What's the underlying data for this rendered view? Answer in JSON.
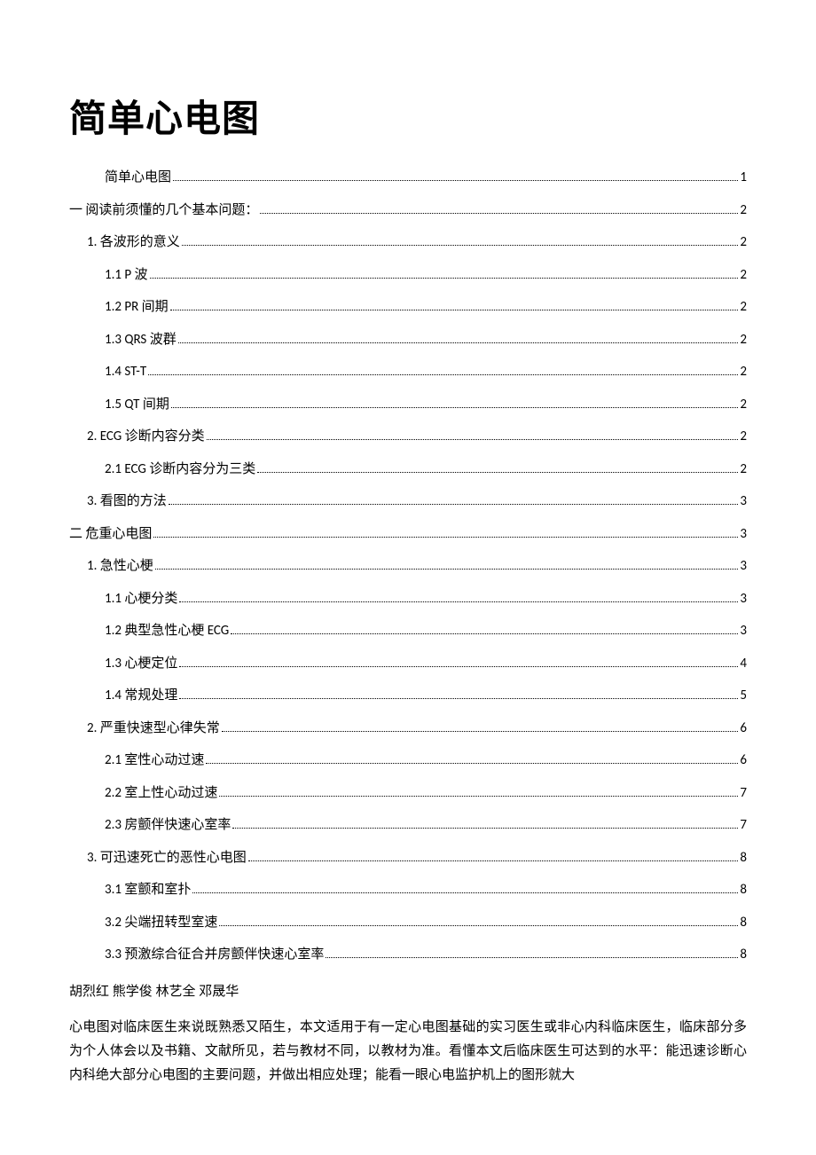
{
  "title": "简单心电图",
  "toc": [
    {
      "label": "简单心电图",
      "page": "1",
      "level": "lvl0c"
    },
    {
      "label": "一  阅读前须懂的几个基本问题：",
      "page": "2",
      "level": "lvl0"
    },
    {
      "label": "1.  各波形的意义",
      "page": "2",
      "level": "lvl1"
    },
    {
      "label": "1.1 P 波",
      "page": "2",
      "level": "lvl2"
    },
    {
      "label": "1.2 PR 间期",
      "page": "2",
      "level": "lvl2"
    },
    {
      "label": "1.3 QRS 波群",
      "page": "2",
      "level": "lvl2"
    },
    {
      "label": "1.4 ST-T",
      "page": "2",
      "level": "lvl2"
    },
    {
      "label": "1.5 QT 间期",
      "page": "2",
      "level": "lvl2"
    },
    {
      "label": "2. ECG 诊断内容分类",
      "page": "2",
      "level": "lvl1"
    },
    {
      "label": "2.1 ECG 诊断内容分为三类",
      "page": "2",
      "level": "lvl2"
    },
    {
      "label": "3.  看图的方法",
      "page": "3",
      "level": "lvl1"
    },
    {
      "label": "二  危重心电图",
      "page": "3",
      "level": "lvl0"
    },
    {
      "label": "1.  急性心梗",
      "page": "3",
      "level": "lvl1"
    },
    {
      "label": "1.1  心梗分类",
      "page": "3",
      "level": "lvl2"
    },
    {
      "label": "1.2  典型急性心梗 ECG",
      "page": "3",
      "level": "lvl2"
    },
    {
      "label": "1.3  心梗定位",
      "page": "4",
      "level": "lvl2"
    },
    {
      "label": "1.4  常规处理",
      "page": "5",
      "level": "lvl2"
    },
    {
      "label": "2.  严重快速型心律失常",
      "page": "6",
      "level": "lvl1"
    },
    {
      "label": "2.1  室性心动过速",
      "page": "6",
      "level": "lvl2"
    },
    {
      "label": "2.2  室上性心动过速",
      "page": "7",
      "level": "lvl2"
    },
    {
      "label": "2.3  房颤伴快速心室率",
      "page": "7",
      "level": "lvl2"
    },
    {
      "label": "3.  可迅速死亡的恶性心电图",
      "page": "8",
      "level": "lvl1"
    },
    {
      "label": "3.1  室颤和室扑",
      "page": "8",
      "level": "lvl2"
    },
    {
      "label": "3.2  尖端扭转型室速",
      "page": "8",
      "level": "lvl2"
    },
    {
      "label": "3.3  预激综合征合并房颤伴快速心室率",
      "page": "8",
      "level": "lvl2"
    }
  ],
  "authors": "胡烈红  熊学俊  林艺全  邓晟华",
  "body_paragraph": "心电图对临床医生来说既熟悉又陌生，本文适用于有一定心电图基础的实习医生或非心内科临床医生，临床部分多为个人体会以及书籍、文献所见，若与教材不同，以教材为准。看懂本文后临床医生可达到的水平：能迅速诊断心内科绝大部分心电图的主要问题，并做出相应处理；能看一眼心电监护机上的图形就大"
}
